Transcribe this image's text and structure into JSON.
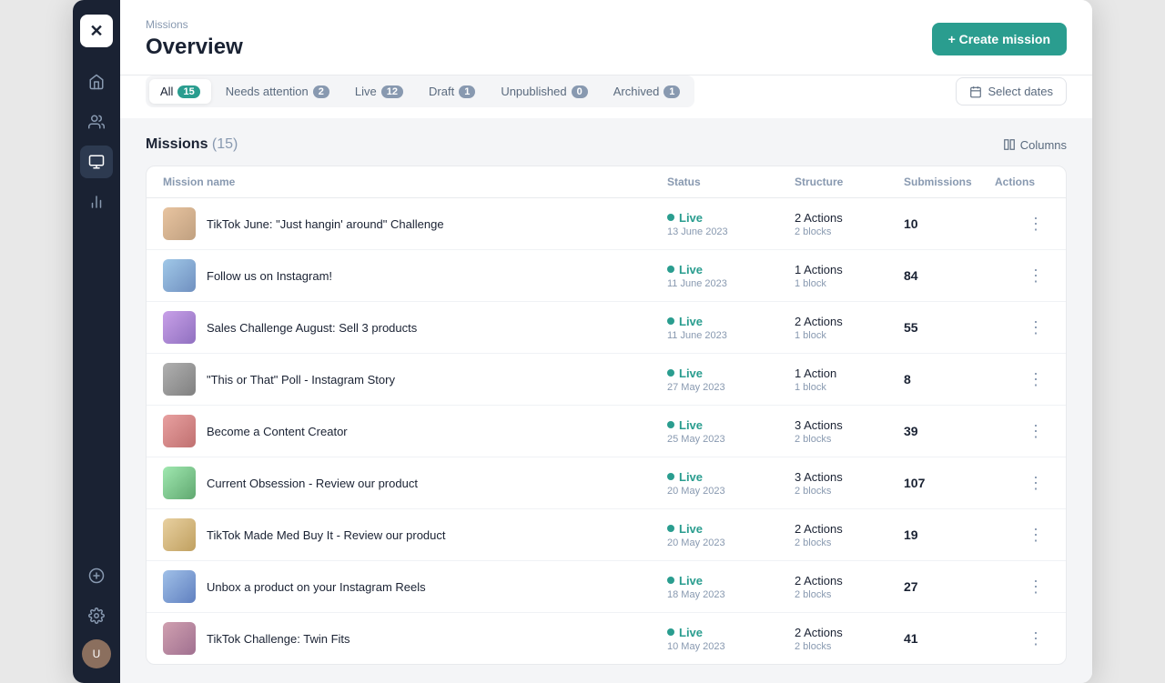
{
  "sidebar": {
    "logo": "✕",
    "items": [
      {
        "name": "home",
        "icon": "home",
        "active": false
      },
      {
        "name": "users",
        "icon": "users",
        "active": false
      },
      {
        "name": "missions",
        "icon": "missions",
        "active": true
      },
      {
        "name": "analytics",
        "icon": "analytics",
        "active": false
      }
    ],
    "bottom": [
      {
        "name": "add",
        "icon": "add"
      },
      {
        "name": "settings",
        "icon": "settings"
      }
    ]
  },
  "header": {
    "breadcrumb": "Missions",
    "title": "Overview",
    "create_btn": "+ Create mission"
  },
  "filters": {
    "tabs": [
      {
        "label": "All",
        "badge": "15",
        "badge_style": "teal",
        "active": true
      },
      {
        "label": "Needs attention",
        "badge": "2",
        "badge_style": "gray",
        "active": false
      },
      {
        "label": "Live",
        "badge": "12",
        "badge_style": "gray",
        "active": false
      },
      {
        "label": "Draft",
        "badge": "1",
        "badge_style": "gray",
        "active": false
      },
      {
        "label": "Unpublished",
        "badge": "0",
        "badge_style": "gray",
        "active": false
      },
      {
        "label": "Archived",
        "badge": "1",
        "badge_style": "gray",
        "active": false
      }
    ],
    "select_dates": "Select dates"
  },
  "missions_section": {
    "title": "Missions",
    "count": "(15)",
    "columns_btn": "Columns",
    "table_headers": [
      "Mission name",
      "Status",
      "Structure",
      "Submissions",
      "Actions"
    ],
    "rows": [
      {
        "name": "TikTok June: \"Just hangin' around\" Challenge",
        "thumb": "t1",
        "status": "Live",
        "date": "13 June 2023",
        "actions": "2 Actions",
        "blocks": "2 blocks",
        "submissions": "10"
      },
      {
        "name": "Follow us on Instagram!",
        "thumb": "t2",
        "status": "Live",
        "date": "11 June 2023",
        "actions": "1 Actions",
        "blocks": "1 block",
        "submissions": "84"
      },
      {
        "name": "Sales Challenge August: Sell 3 products",
        "thumb": "t3",
        "status": "Live",
        "date": "11 June 2023",
        "actions": "2 Actions",
        "blocks": "1 block",
        "submissions": "55"
      },
      {
        "name": "\"This or That\" Poll - Instagram Story",
        "thumb": "t4",
        "status": "Live",
        "date": "27 May 2023",
        "actions": "1 Action",
        "blocks": "1 block",
        "submissions": "8"
      },
      {
        "name": "Become a Content Creator",
        "thumb": "t5",
        "status": "Live",
        "date": "25 May 2023",
        "actions": "3 Actions",
        "blocks": "2 blocks",
        "submissions": "39"
      },
      {
        "name": "Current Obsession - Review our product",
        "thumb": "t6",
        "status": "Live",
        "date": "20 May 2023",
        "actions": "3 Actions",
        "blocks": "2 blocks",
        "submissions": "107"
      },
      {
        "name": "TikTok Made Med Buy It - Review our product",
        "thumb": "t7",
        "status": "Live",
        "date": "20 May 2023",
        "actions": "2 Actions",
        "blocks": "2 blocks",
        "submissions": "19"
      },
      {
        "name": "Unbox a product on your Instagram Reels",
        "thumb": "t8",
        "status": "Live",
        "date": "18 May 2023",
        "actions": "2 Actions",
        "blocks": "2 blocks",
        "submissions": "27"
      },
      {
        "name": "TikTok Challenge: Twin Fits",
        "thumb": "t9",
        "status": "Live",
        "date": "10 May 2023",
        "actions": "2 Actions",
        "blocks": "2 blocks",
        "submissions": "41"
      }
    ]
  }
}
